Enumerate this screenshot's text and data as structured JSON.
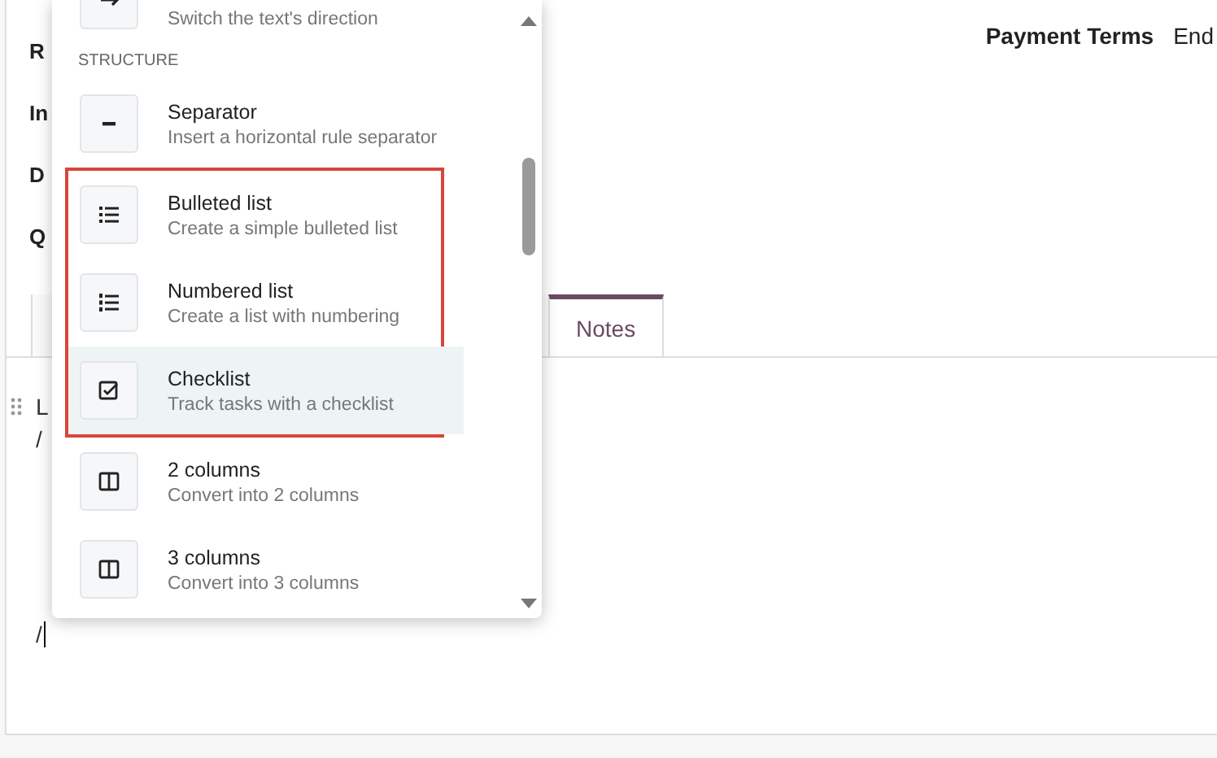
{
  "form": {
    "left_labels": [
      "R",
      "In",
      "D",
      "Q"
    ],
    "right_labels": [
      "Payment Terms",
      "End"
    ]
  },
  "tabs": [
    {
      "selected": false
    },
    {
      "label": "Notes",
      "selected": true
    }
  ],
  "editor": {
    "lines": [
      "L",
      "/"
    ],
    "last_line": "/"
  },
  "command_menu": {
    "top_item": {
      "kind": "direction",
      "description": "Switch the text's direction"
    },
    "section": "STRUCTURE",
    "items": [
      {
        "kind": "separator",
        "title": "Separator",
        "description": "Insert a horizontal rule separator",
        "selected": false,
        "outlined": false
      },
      {
        "kind": "bulleted",
        "title": "Bulleted list",
        "description": "Create a simple bulleted list",
        "selected": false,
        "outlined": true
      },
      {
        "kind": "numbered",
        "title": "Numbered list",
        "description": "Create a list with numbering",
        "selected": false,
        "outlined": true
      },
      {
        "kind": "checklist",
        "title": "Checklist",
        "description": "Track tasks with a checklist",
        "selected": true,
        "outlined": true
      },
      {
        "kind": "columns2",
        "title": "2 columns",
        "description": "Convert into 2 columns",
        "selected": false,
        "outlined": false
      },
      {
        "kind": "columns3",
        "title": "3 columns",
        "description": "Convert into 3 columns",
        "selected": false,
        "outlined": false
      }
    ]
  }
}
